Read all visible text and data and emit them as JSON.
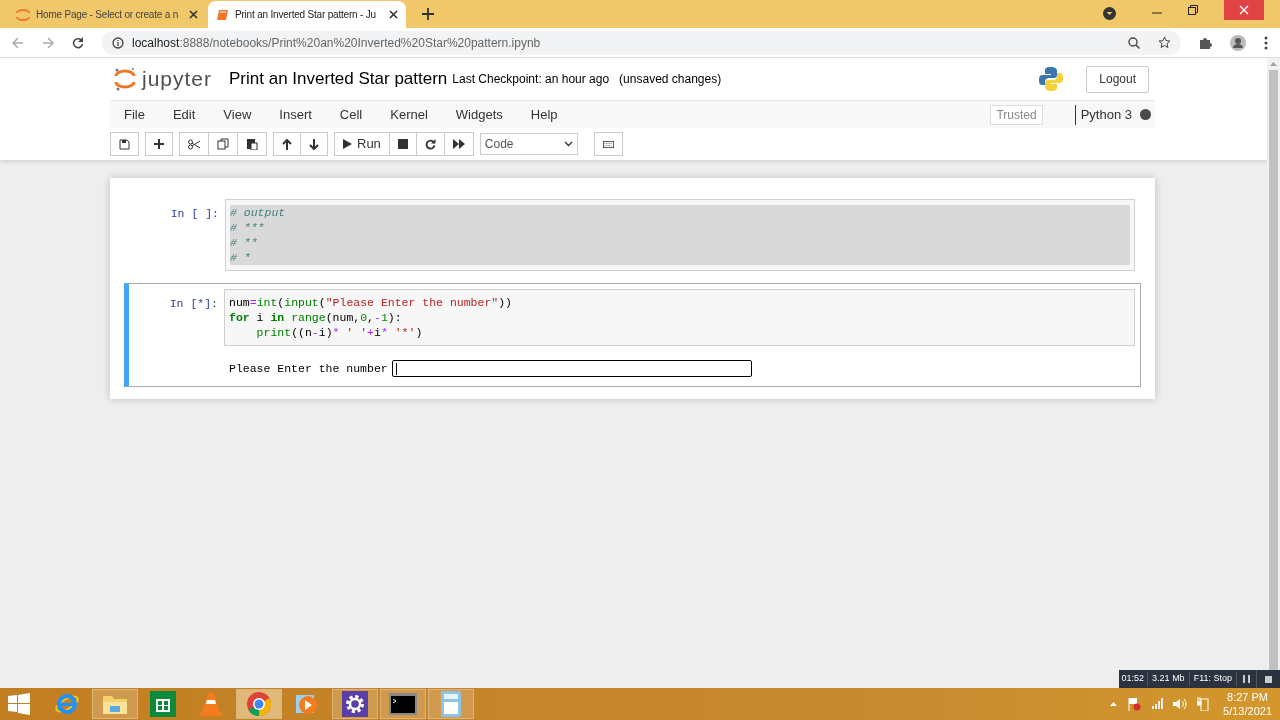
{
  "browser": {
    "tabs": [
      {
        "title": "Home Page - Select or create a n",
        "kind": "jupyter",
        "selected": false
      },
      {
        "title": "Print an Inverted Star pattern - Ju",
        "kind": "notebook",
        "selected": true
      }
    ],
    "url_host": "localhost",
    "url_rest": ":8888/notebooks/Print%20an%20Inverted%20Star%20pattern.ipynb"
  },
  "notebook": {
    "logo_text": "jupyter",
    "title": "Print an Inverted Star pattern",
    "checkpoint": "Last Checkpoint: an hour ago",
    "unsaved": "(unsaved changes)",
    "logout": "Logout",
    "menu": [
      "File",
      "Edit",
      "View",
      "Insert",
      "Cell",
      "Kernel",
      "Widgets",
      "Help"
    ],
    "trusted": "Trusted",
    "kernel": "Python 3",
    "kernel_busy": true,
    "run_label": "Run",
    "cell_type": "Code"
  },
  "cells": [
    {
      "prompt": "In [ ]:",
      "selected": false,
      "highlighted": true,
      "lines": [
        [
          {
            "kind": "comment",
            "text": "# output"
          }
        ],
        [
          {
            "kind": "comment",
            "text": "# ***"
          }
        ],
        [
          {
            "kind": "comment",
            "text": "# **"
          }
        ],
        [
          {
            "kind": "comment",
            "text": "# *"
          }
        ]
      ]
    },
    {
      "prompt": "In [*]:",
      "selected": true,
      "highlighted": false,
      "lines": [
        [
          {
            "kind": "plain",
            "text": "num"
          },
          {
            "kind": "operator",
            "text": "="
          },
          {
            "kind": "builtin",
            "text": "int"
          },
          {
            "kind": "plain",
            "text": "("
          },
          {
            "kind": "builtin",
            "text": "input"
          },
          {
            "kind": "plain",
            "text": "("
          },
          {
            "kind": "string",
            "text": "\"Please Enter the number\""
          },
          {
            "kind": "plain",
            "text": "))"
          }
        ],
        [
          {
            "kind": "keyword",
            "text": "for"
          },
          {
            "kind": "plain",
            "text": " i "
          },
          {
            "kind": "keyword",
            "text": "in"
          },
          {
            "kind": "builtin",
            "text": " range"
          },
          {
            "kind": "plain",
            "text": "(num,"
          },
          {
            "kind": "number",
            "text": "0"
          },
          {
            "kind": "plain",
            "text": ","
          },
          {
            "kind": "operator",
            "text": "-"
          },
          {
            "kind": "number",
            "text": "1"
          },
          {
            "kind": "plain",
            "text": "):"
          }
        ],
        [
          {
            "kind": "builtin",
            "text": "    print"
          },
          {
            "kind": "plain",
            "text": "((n"
          },
          {
            "kind": "operator",
            "text": "-"
          },
          {
            "kind": "plain",
            "text": "i)"
          },
          {
            "kind": "operator",
            "text": "*"
          },
          {
            "kind": "string",
            "text": " ' '"
          },
          {
            "kind": "operator",
            "text": "+"
          },
          {
            "kind": "plain",
            "text": "i"
          },
          {
            "kind": "operator",
            "text": "*"
          },
          {
            "kind": "string",
            "text": " '*'"
          },
          {
            "kind": "plain",
            "text": ")"
          }
        ]
      ],
      "input_prompt": "Please Enter the number"
    }
  ],
  "recorder": {
    "time": "01:52",
    "size": "3.21 Mb",
    "hotkey": "F11: Stop"
  },
  "taskbar": {
    "apps": [
      {
        "kind": "ie",
        "running": false,
        "selected": false
      },
      {
        "kind": "folder",
        "running": true,
        "selected": false
      },
      {
        "kind": "store",
        "running": false,
        "selected": false
      },
      {
        "kind": "cone",
        "running": false,
        "selected": false
      },
      {
        "kind": "chrome",
        "running": true,
        "selected": true
      },
      {
        "kind": "player",
        "running": false,
        "selected": false
      },
      {
        "kind": "gear",
        "running": true,
        "selected": false
      },
      {
        "kind": "terminal",
        "running": true,
        "selected": false
      },
      {
        "kind": "calculator",
        "running": true,
        "selected": false
      }
    ],
    "time": "8:27 PM",
    "date": "5/13/2021"
  }
}
